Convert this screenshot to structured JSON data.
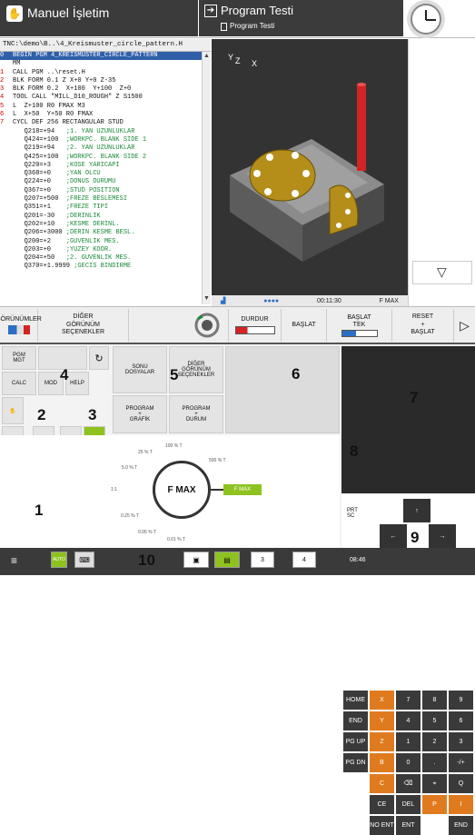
{
  "mode_left": "Manuel İşletim",
  "mode_right_title": "Program Testi",
  "mode_right_sub": "Program Testi",
  "path": "TNC:\\demo\\B..\\4_Kreismuster_circle_pattern.H",
  "code": [
    {
      "n": "0",
      "t": "BEGIN PGM 4_KREISMUSTER_CIRCLE_PATTERN",
      "c": "",
      "sel": true
    },
    {
      "n": "",
      "t": "MM",
      "c": ""
    },
    {
      "n": "1",
      "t": "CALL PGM ..\\reset.H",
      "c": ""
    },
    {
      "n": "2",
      "t": "BLK FORM 0.1 Z X+0 Y+0 Z-35",
      "c": ""
    },
    {
      "n": "3",
      "t": "BLK FORM 0.2  X+100  Y+100  Z+0",
      "c": ""
    },
    {
      "n": "4",
      "t": "TOOL CALL \"MILL_D10_ROUGH\" Z S1500",
      "c": ""
    },
    {
      "n": "5",
      "t": "L  Z+100 R0 FMAX M3",
      "c": ""
    },
    {
      "n": "6",
      "t": "L  X+50  Y+50 R0 FMAX",
      "c": ""
    },
    {
      "n": "7",
      "t": "CYCL DEF 256 RECTANGULAR STUD",
      "c": ""
    },
    {
      "n": "",
      "t": "   Q218=+94   ",
      "c": ";1. YAN UZUNLUKLAR"
    },
    {
      "n": "",
      "t": "   Q424=+100  ",
      "c": ";WORKPC. BLANK SIDE 1"
    },
    {
      "n": "",
      "t": "   Q219=+94   ",
      "c": ";2. YAN UZUNLUKLAR"
    },
    {
      "n": "",
      "t": "   Q425=+100  ",
      "c": ";WORKPC. BLANK SIDE 2"
    },
    {
      "n": "",
      "t": "   Q220=+3    ",
      "c": ";KOSE YARICAPI"
    },
    {
      "n": "",
      "t": "   Q368=+0    ",
      "c": ";YAN OLCU"
    },
    {
      "n": "",
      "t": "   Q224=+0    ",
      "c": ";DONUS DURUMU"
    },
    {
      "n": "",
      "t": "   Q367=+0    ",
      "c": ";STUD POSITION"
    },
    {
      "n": "",
      "t": "   Q207=+500  ",
      "c": ";FREZE BESLEMESI"
    },
    {
      "n": "",
      "t": "   Q351=+1    ",
      "c": ";FREZE TIPI"
    },
    {
      "n": "",
      "t": "   Q201=-30   ",
      "c": ";DERINLIK"
    },
    {
      "n": "",
      "t": "   Q202=+10   ",
      "c": ";KESME DERINL."
    },
    {
      "n": "",
      "t": "   Q206=+3000 ",
      "c": ";DERIN KESME BESL."
    },
    {
      "n": "",
      "t": "   Q200=+2    ",
      "c": ";GUVENLIK MES."
    },
    {
      "n": "",
      "t": "   Q203=+0    ",
      "c": ";YUZEY KOOR."
    },
    {
      "n": "",
      "t": "   Q204=+50   ",
      "c": ";2. GUVENLIK MES."
    },
    {
      "n": "",
      "t": "   Q370=+1.9999 ",
      "c": ";GECIS BINDIRME"
    }
  ],
  "axis": {
    "y": "Y",
    "z": "Z",
    "x": "X"
  },
  "view_status": {
    "time": "00:11:30",
    "feed": "F MAX"
  },
  "softkeys": {
    "views": "GÖRÜNÜMLER",
    "other_views": "DİĞER\nGÖRÜNÜM\nSEÇENEKLER",
    "stop": "DURDUR",
    "start": "BAŞLAT",
    "start_single": "BAŞLAT\nTEK",
    "reset_start": "RESET\n+\nBAŞLAT"
  },
  "gest": {
    "pgm_mgt": "PGM\nMGT",
    "calc": "CALC",
    "mod": "MOD",
    "help": "HELP",
    "sonu": "SONU\nDOSYALAR",
    "diger": "DİĞER\nGÖRÜNÜM\nSEÇENEKLER",
    "pg_grafik": "PROGRAM\n+\nGRAFİK",
    "pg_durum": "PROGRAM\n+\nDURUM"
  },
  "callouts": [
    "1",
    "2",
    "3",
    "4",
    "5",
    "6",
    "7",
    "8",
    "9",
    "10"
  ],
  "override": {
    "center": "F MAX",
    "right": "F MAX",
    "labels": [
      "100 % T",
      "25 % T",
      "5.0 % T",
      "1:1",
      "0.25 % T",
      "0.05 % T",
      "0.01 % T",
      "500 % T"
    ]
  },
  "keys": [
    [
      "HOME",
      "X",
      "7",
      "8",
      "9"
    ],
    [
      "END",
      "Y",
      "4",
      "5",
      "6"
    ],
    [
      "PG UP",
      "Z",
      "1",
      "2",
      "3"
    ],
    [
      "PG DN",
      "B",
      "0",
      ".",
      "-/+"
    ],
    [
      "",
      "C",
      "⌫",
      "⌖",
      "Q"
    ],
    [
      "",
      "CE",
      "DEL",
      "P",
      "I"
    ],
    [
      "",
      "NO ENT",
      "ENT",
      "",
      "END"
    ]
  ],
  "prt_sc": "PRT\nSC",
  "clock": "08:46",
  "taskbar": {
    "auto": "AUTO",
    "t3": "3",
    "t4": "4"
  }
}
